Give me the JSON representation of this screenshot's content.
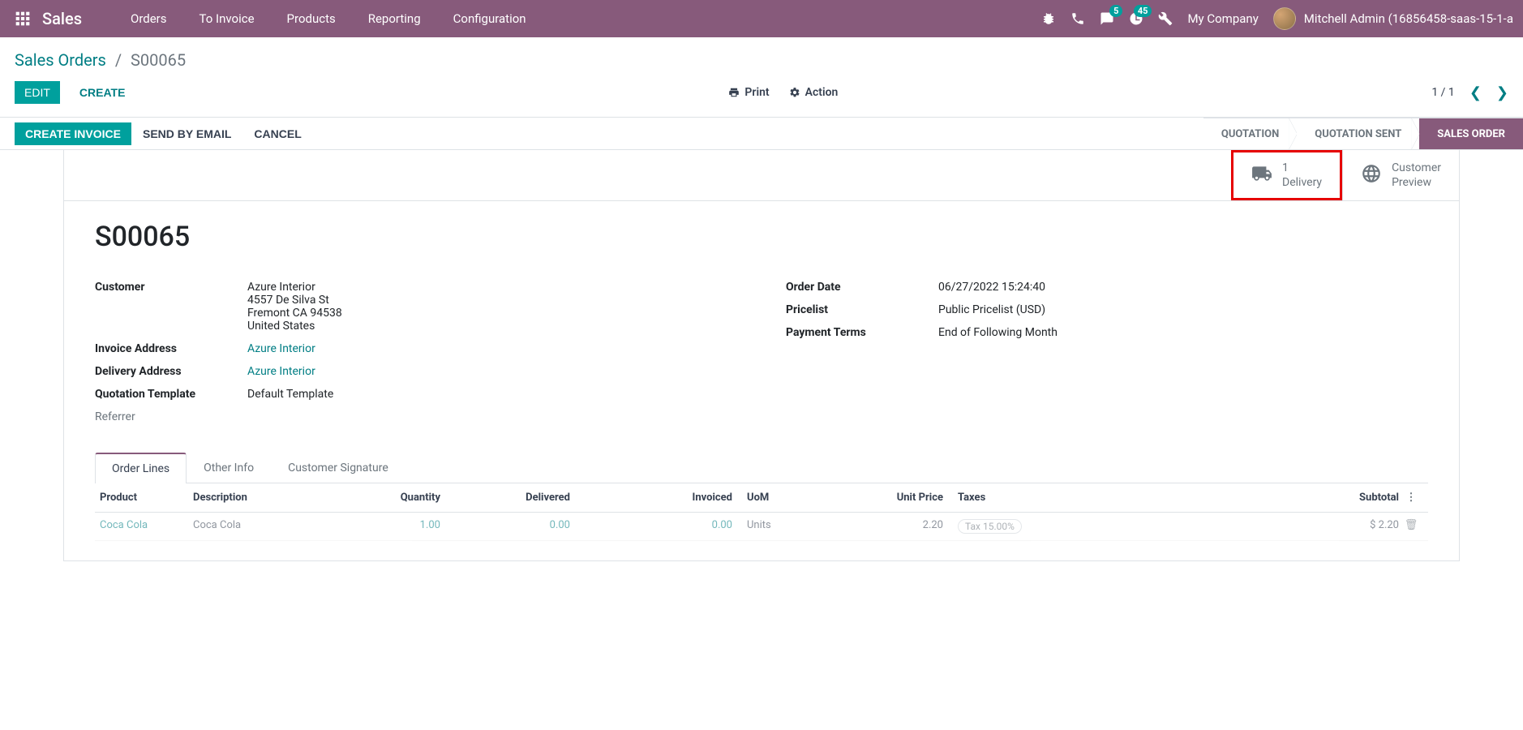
{
  "nav": {
    "brand": "Sales",
    "links": [
      "Orders",
      "To Invoice",
      "Products",
      "Reporting",
      "Configuration"
    ],
    "msg_badge": "5",
    "activity_badge": "45",
    "company": "My Company",
    "username": "Mitchell Admin (16856458-saas-15-1-a"
  },
  "breadcrumb": {
    "parent": "Sales Orders",
    "current": "S00065"
  },
  "controls": {
    "edit": "EDIT",
    "create": "CREATE",
    "print": "Print",
    "action": "Action",
    "pager": "1 / 1"
  },
  "actions": {
    "create_invoice": "CREATE INVOICE",
    "send_email": "SEND BY EMAIL",
    "cancel": "CANCEL"
  },
  "stages": {
    "quotation": "QUOTATION",
    "quotation_sent": "QUOTATION SENT",
    "sales_order": "SALES ORDER"
  },
  "stats": {
    "delivery_count": "1",
    "delivery_label": "Delivery",
    "preview_l1": "Customer",
    "preview_l2": "Preview"
  },
  "record": {
    "name": "S00065",
    "labels": {
      "customer": "Customer",
      "invoice_address": "Invoice Address",
      "delivery_address": "Delivery Address",
      "quotation_template": "Quotation Template",
      "referrer": "Referrer",
      "order_date": "Order Date",
      "pricelist": "Pricelist",
      "payment_terms": "Payment Terms"
    },
    "customer_name": "Azure Interior",
    "customer_addr1": "4557 De Silva St",
    "customer_addr2": "Fremont CA 94538",
    "customer_addr3": "United States",
    "invoice_address": "Azure Interior",
    "delivery_address": "Azure Interior",
    "quotation_template": "Default Template",
    "order_date": "06/27/2022 15:24:40",
    "pricelist": "Public Pricelist (USD)",
    "payment_terms": "End of Following Month"
  },
  "tabs": {
    "order_lines": "Order Lines",
    "other_info": "Other Info",
    "customer_signature": "Customer Signature"
  },
  "table": {
    "headers": {
      "product": "Product",
      "description": "Description",
      "quantity": "Quantity",
      "delivered": "Delivered",
      "invoiced": "Invoiced",
      "uom": "UoM",
      "unit_price": "Unit Price",
      "taxes": "Taxes",
      "subtotal": "Subtotal"
    },
    "row": {
      "product": "Coca Cola",
      "description": "Coca Cola",
      "quantity": "1.00",
      "delivered": "0.00",
      "invoiced": "0.00",
      "uom": "Units",
      "unit_price": "2.20",
      "taxes": "Tax 15.00%",
      "subtotal": "$ 2.20"
    }
  }
}
